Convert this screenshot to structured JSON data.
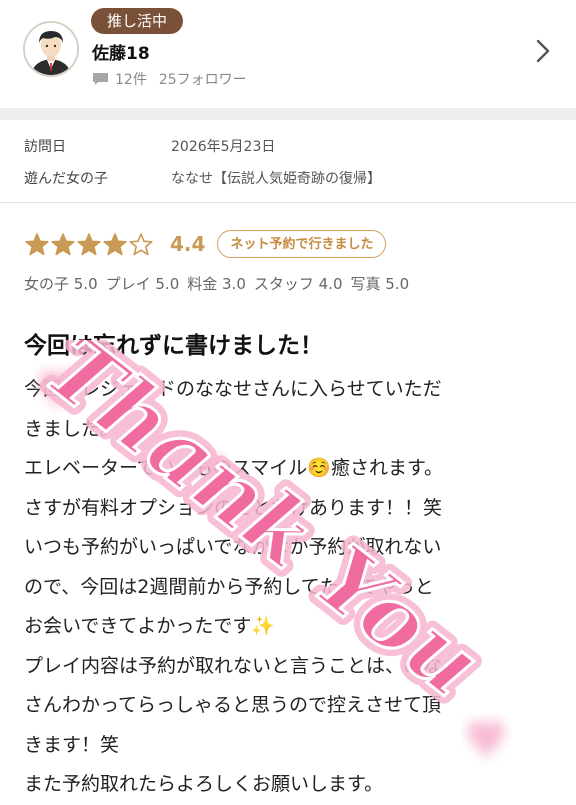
{
  "profile": {
    "badge": "推し活中",
    "username": "佐藤18",
    "review_count": "12件",
    "followers": "25フォロワー"
  },
  "visit": {
    "date_label": "訪問日",
    "date_value": "2026年5月23日",
    "girl_label": "遊んだ女の子",
    "girl_value": "ななせ【伝説人気姫奇跡の復帰】"
  },
  "rating": {
    "stars_filled": 4,
    "stars_total": 5,
    "score": "4.4",
    "booking_badge": "ネット予約で行きました",
    "subscores": [
      "女の子 5.0",
      "プレイ 5.0",
      "料金 3.0",
      "スタッフ 4.0",
      "写真 5.0"
    ]
  },
  "review": {
    "title": "今回は忘れずに書けました！",
    "lines": [
      "今回もレジェンドのななせさんに入らせていただ",
      "きました。",
      "エレベーターでいつものスマイル☺️癒されます。",
      "さすが有料オプションのことだけあります！！笑",
      "いつも予約がいっぱいでなかなか予約が取れない",
      "ので、今回は2週間前から予約してたのでやっと",
      "お会いできてよかったです✨",
      "プレイ内容は予約が取れないと言うことは、みな",
      "さんわかってらっしゃると思うので控えさせて頂",
      "きます！笑",
      "また予約取れたらよろしくお願いします。"
    ]
  },
  "watermark": {
    "text": "Thank You",
    "color": "#f06ca0"
  },
  "colors": {
    "accent": "#c89a55",
    "badge_bg": "#7a5138"
  }
}
